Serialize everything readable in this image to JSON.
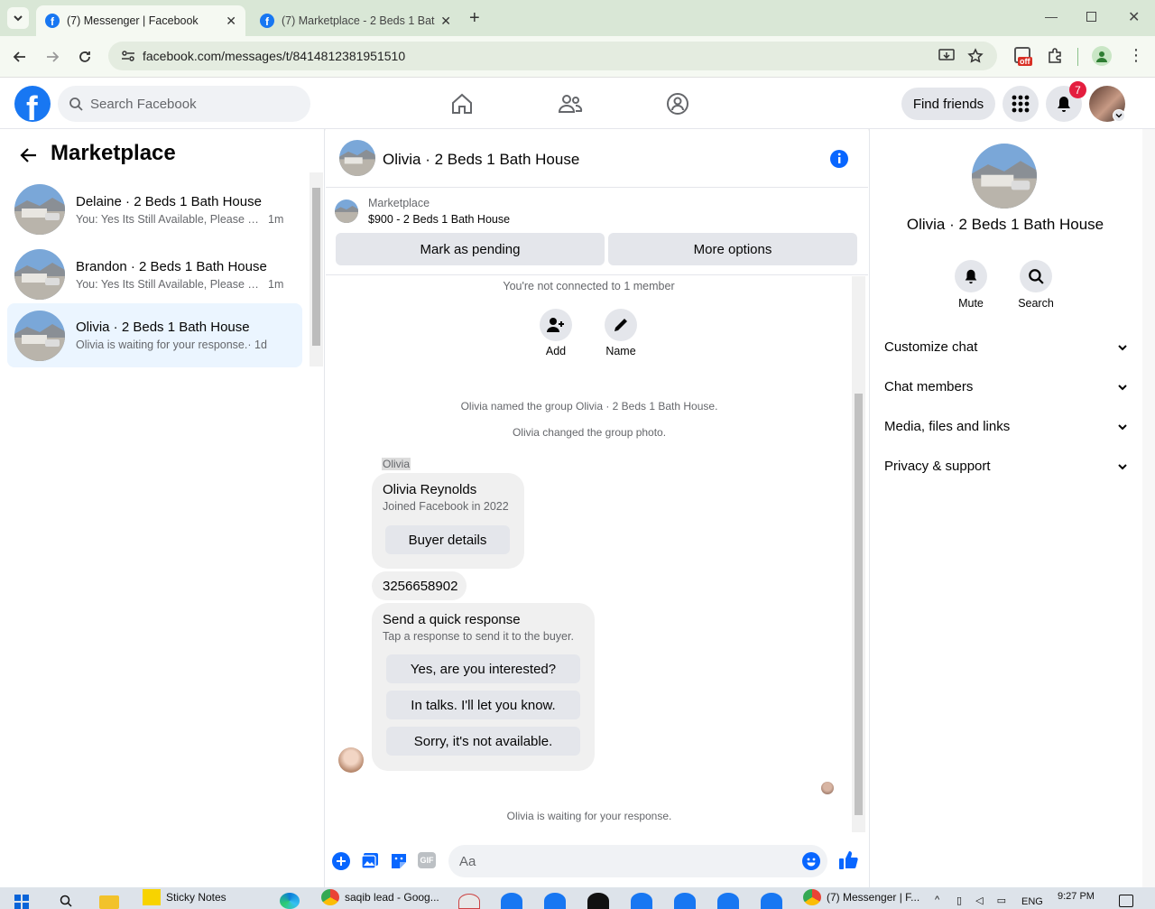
{
  "browser": {
    "tabs": [
      {
        "title": "(7) Messenger | Facebook",
        "active": true
      },
      {
        "title": "(7) Marketplace - 2 Beds 1 Bath",
        "active": false
      }
    ],
    "url": "facebook.com/messages/t/8414812381951510",
    "extension_badge": "off"
  },
  "header": {
    "search_placeholder": "Search Facebook",
    "find_friends": "Find friends",
    "notif_count": "7",
    "brand_color": "#1877f2"
  },
  "left": {
    "title": "Marketplace",
    "conversations": [
      {
        "name": "Delaine · 2 Beds 1 Bath House",
        "preview": "You: Yes Its Still Available, Please S...",
        "time": "1m",
        "selected": false
      },
      {
        "name": "Brandon · 2 Beds 1 Bath House",
        "preview": "You: Yes Its Still Available, Please S...",
        "time": "1m",
        "selected": false
      },
      {
        "name": "Olivia · 2 Beds 1 Bath House",
        "preview": "Olivia is waiting for your response.",
        "time": "· 1d",
        "selected": true
      }
    ]
  },
  "chat": {
    "title": "Olivia · 2 Beds 1 Bath House",
    "listing": {
      "label": "Marketplace",
      "price_title": "$900 - 2 Beds 1 Bath House"
    },
    "mark_pending": "Mark as pending",
    "more_options": "More options",
    "not_connected": "You're not connected to 1 member",
    "actions": [
      {
        "label": "Add",
        "icon": "add-person-icon"
      },
      {
        "label": "Name",
        "icon": "pencil-icon"
      }
    ],
    "system_messages": [
      "Olivia named the group Olivia · 2 Beds 1 Bath House.",
      "Olivia changed the group photo."
    ],
    "sender_label": "Olivia",
    "buyer_card": {
      "name": "Olivia Reynolds",
      "joined": "Joined Facebook in 2022",
      "button": "Buyer details"
    },
    "phone_message": "3256658902",
    "quick_response": {
      "title": "Send a quick response",
      "subtitle": "Tap a response to send it to the buyer.",
      "options": [
        "Yes, are you interested?",
        "In talks. I'll let you know.",
        "Sorry, it's not available."
      ]
    },
    "waiting": "Olivia is waiting for your response.",
    "composer_placeholder": "Aa"
  },
  "details": {
    "title": "Olivia · 2 Beds 1 Bath House",
    "mute": "Mute",
    "search": "Search",
    "sections": [
      "Customize chat",
      "Chat members",
      "Media, files and links",
      "Privacy & support"
    ]
  },
  "taskbar": {
    "items": [
      "Sticky Notes",
      "saqib lead - Goog...",
      "(7) Messenger | F..."
    ],
    "lang": "ENG",
    "time": "9:27 PM"
  }
}
